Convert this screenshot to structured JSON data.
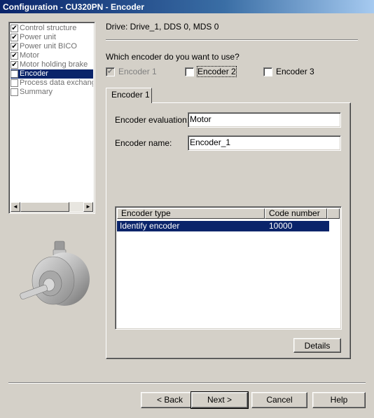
{
  "window": {
    "title": "Configuration - CU320PN - Encoder"
  },
  "tree": {
    "items": [
      {
        "label": "Control structure",
        "checked": true,
        "selected": false
      },
      {
        "label": "Power unit",
        "checked": true,
        "selected": false
      },
      {
        "label": "Power unit BICO",
        "checked": true,
        "selected": false
      },
      {
        "label": "Motor",
        "checked": true,
        "selected": false
      },
      {
        "label": "Motor holding brake",
        "checked": true,
        "selected": false
      },
      {
        "label": "Encoder",
        "checked": false,
        "selected": true
      },
      {
        "label": "Process data exchang",
        "checked": false,
        "selected": false
      },
      {
        "label": "Summary",
        "checked": false,
        "selected": false
      }
    ],
    "scroll_left_glyph": "◄",
    "scroll_right_glyph": "►"
  },
  "drive_label": "Drive: Drive_1, DDS 0, MDS 0",
  "question": "Which encoder do you want to use?",
  "encoders": [
    {
      "label": "Encoder 1",
      "checked": true,
      "enabled": false
    },
    {
      "label": "Encoder 2",
      "checked": false,
      "enabled": true
    },
    {
      "label": "Encoder 3",
      "checked": false,
      "enabled": true
    }
  ],
  "tab": {
    "label": "Encoder 1"
  },
  "form": {
    "evaluation_label": "Encoder evaluation:",
    "evaluation_value": "Motor",
    "name_label": "Encoder name:",
    "name_value": "Encoder_1"
  },
  "table": {
    "columns": [
      "Encoder type",
      "Code number"
    ],
    "rows": [
      [
        "Identify encoder",
        "10000"
      ]
    ]
  },
  "buttons": {
    "details": "Details",
    "back": "< Back",
    "next": "Next >",
    "cancel": "Cancel",
    "help": "Help"
  },
  "check_glyph": "✔"
}
